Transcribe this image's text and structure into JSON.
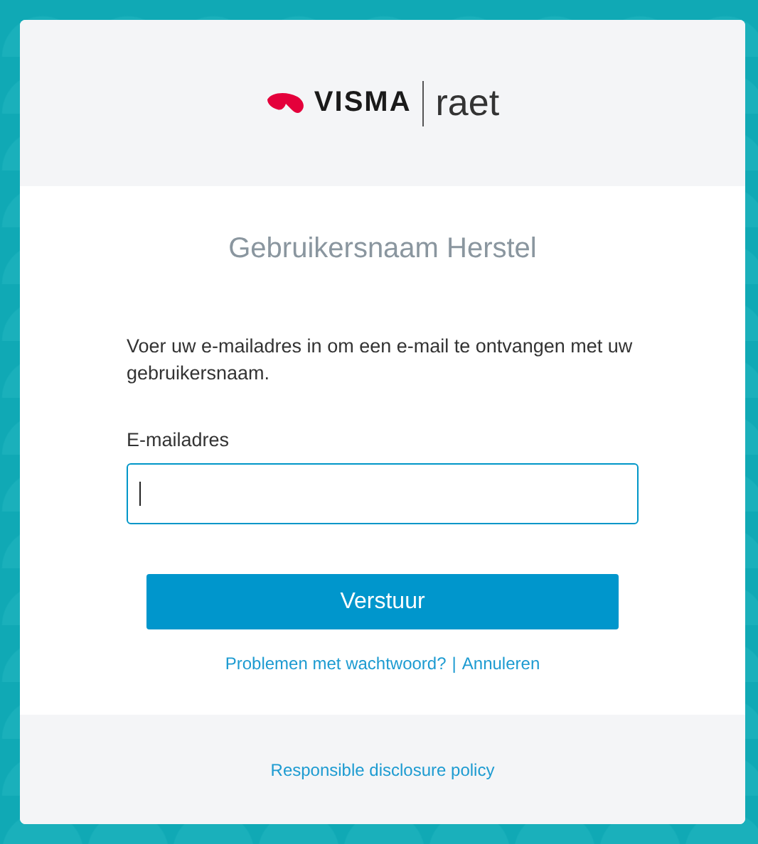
{
  "logo": {
    "brand": "VISMA",
    "product": "raet"
  },
  "title": "Gebruikersnaam Herstel",
  "instruction": "Voer uw e-mailadres in om een e-mail te ontvangen met uw gebruikersnaam.",
  "email_field": {
    "label": "E-mailadres",
    "focused": true
  },
  "submit_button": "Verstuur",
  "links": [
    {
      "label": "Problemen met wachtwoord?"
    },
    {
      "label": "Annuleren"
    }
  ],
  "link_separator": "|",
  "footer_link": "Responsible disclosure policy"
}
